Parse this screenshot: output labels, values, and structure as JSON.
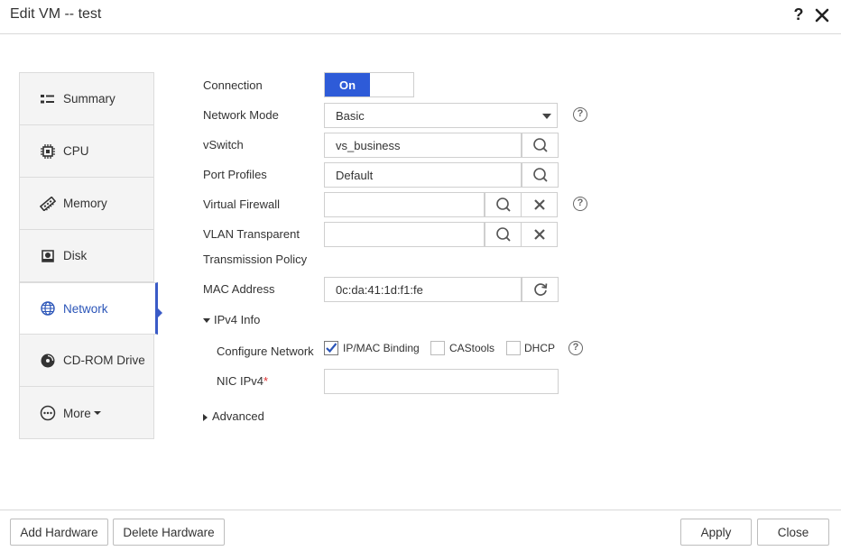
{
  "dialog": {
    "title": "Edit VM -- test",
    "help": "?"
  },
  "sidebar": {
    "items": [
      {
        "label": "Summary",
        "icon": "summary-icon"
      },
      {
        "label": "CPU",
        "icon": "cpu-icon"
      },
      {
        "label": "Memory",
        "icon": "memory-icon"
      },
      {
        "label": "Disk",
        "icon": "disk-icon"
      },
      {
        "label": "Network",
        "icon": "globe-icon",
        "active": true
      },
      {
        "label": "CD-ROM Drive",
        "icon": "cdrom-icon"
      },
      {
        "label": "More",
        "icon": "more-icon"
      }
    ]
  },
  "form": {
    "connection": {
      "label": "Connection",
      "value": "On"
    },
    "network_mode": {
      "label": "Network Mode",
      "value": "Basic"
    },
    "vswitch": {
      "label": "vSwitch",
      "value": "vs_business"
    },
    "port_profiles": {
      "label": "Port Profiles",
      "value": "Default"
    },
    "virtual_firewall": {
      "label": "Virtual Firewall",
      "value": ""
    },
    "vlan": {
      "label_line1": "VLAN Transparent",
      "label_line2": "Transmission Policy",
      "value": ""
    },
    "mac_address": {
      "label": "MAC Address",
      "value": "0c:da:41:1d:f1:fe"
    },
    "ipv4_info": {
      "label": "IPv4 Info",
      "expanded": true
    },
    "configure_network": {
      "label": "Configure Network",
      "options": [
        {
          "label": "IP/MAC Binding",
          "checked": true
        },
        {
          "label": "CAStools",
          "checked": false
        },
        {
          "label": "DHCP",
          "checked": false
        }
      ]
    },
    "nic_ipv4": {
      "label": "NIC IPv4",
      "required_mark": "*",
      "value": ""
    },
    "advanced": {
      "label": "Advanced",
      "expanded": false
    }
  },
  "footer": {
    "add_hardware": "Add Hardware",
    "delete_hardware": "Delete Hardware",
    "apply": "Apply",
    "close": "Close"
  },
  "colors": {
    "accent": "#2e5bd8",
    "active_text": "#2b55b8",
    "required": "#e03030"
  }
}
